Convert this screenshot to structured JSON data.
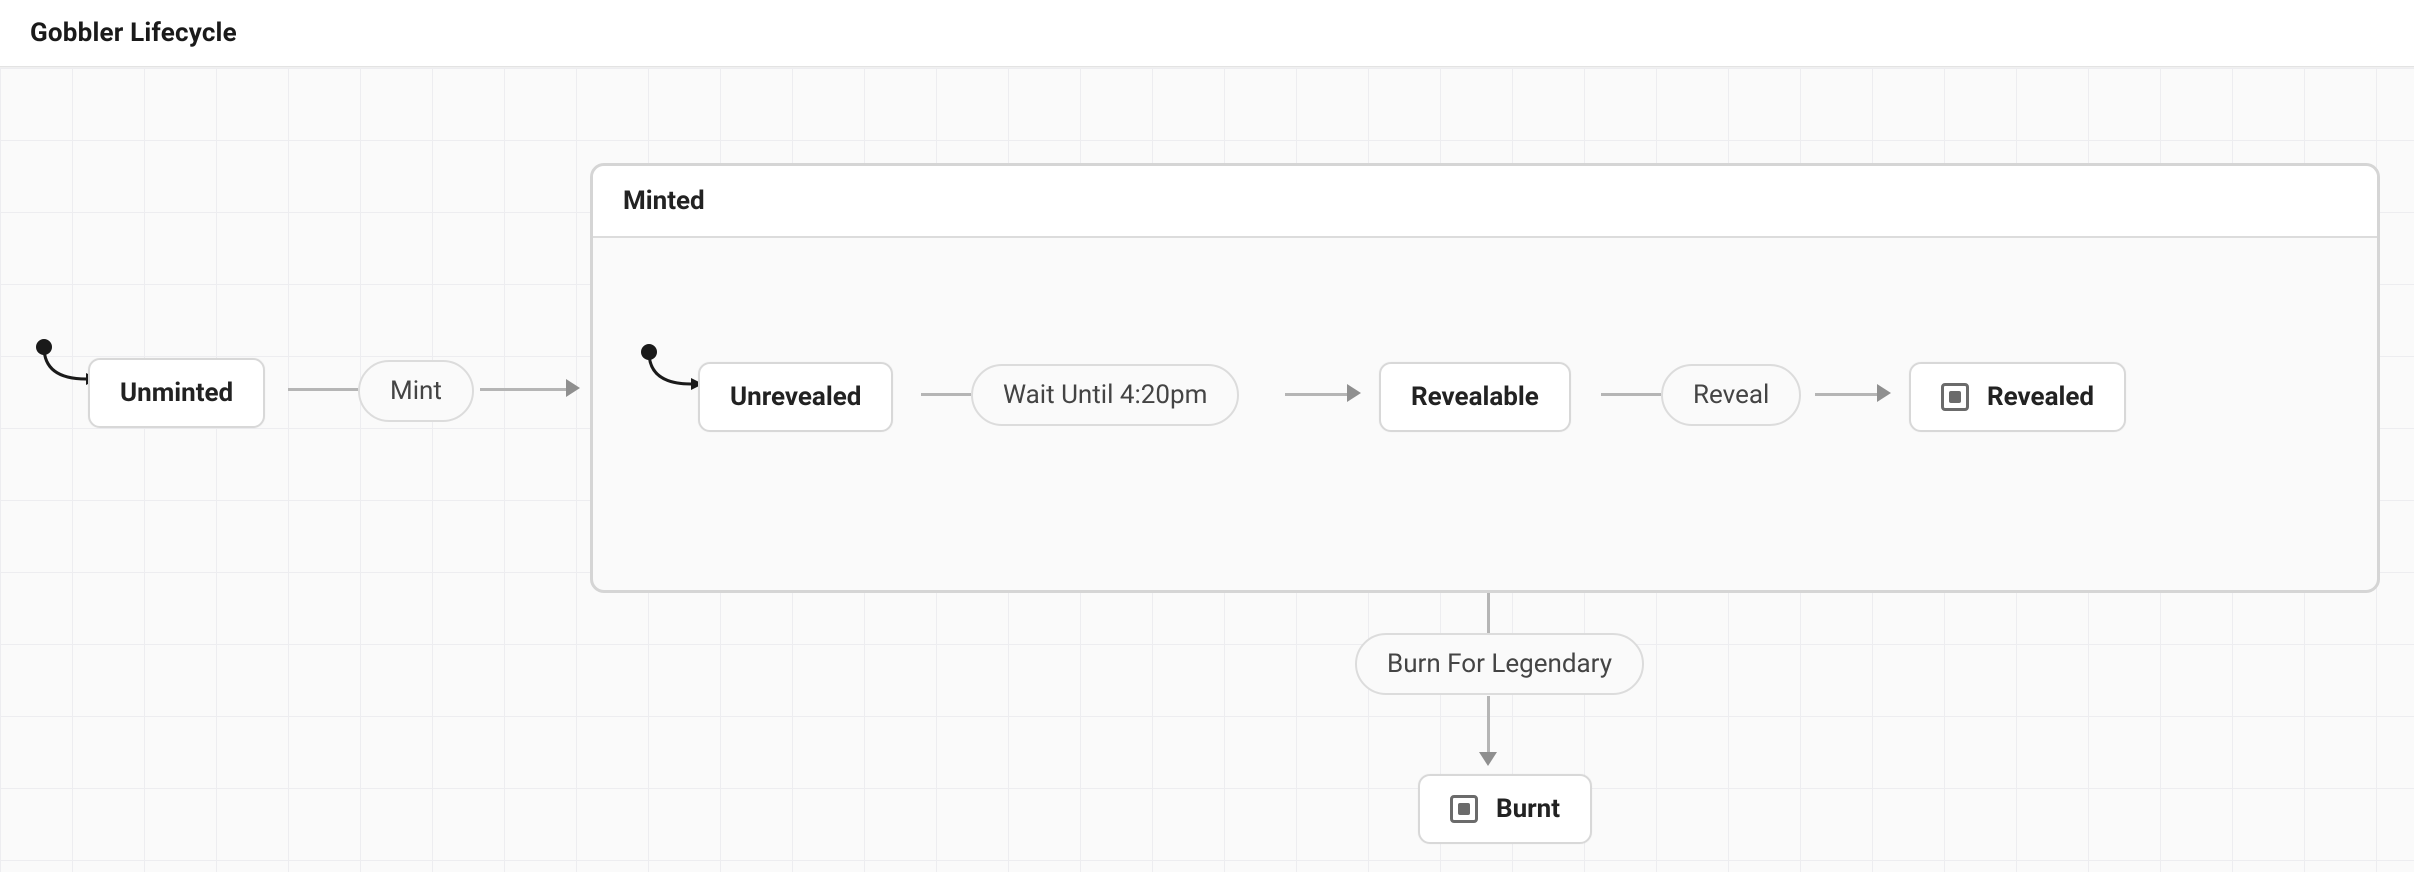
{
  "title": "Gobbler Lifecycle",
  "states": {
    "unminted": "Unminted",
    "minted": "Minted",
    "unrevealed": "Unrevealed",
    "revealable": "Revealable",
    "revealed": "Revealed",
    "burnt": "Burnt"
  },
  "events": {
    "mint": "Mint",
    "wait": "Wait Until 4:20pm",
    "reveal": "Reveal",
    "burn": "Burn For Legendary"
  }
}
